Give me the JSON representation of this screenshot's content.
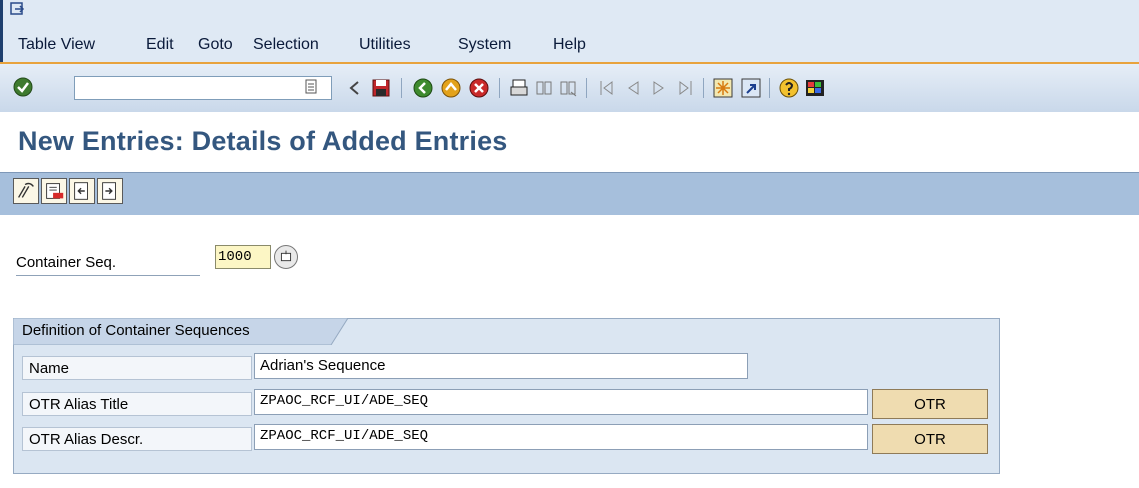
{
  "menu": {
    "items": [
      "Table View",
      "Edit",
      "Goto",
      "Selection",
      "Utilities",
      "System",
      "Help"
    ]
  },
  "toolbar": {
    "command_value": "",
    "icons": [
      "enter-icon",
      "history-dropdown-icon",
      "back-arrow-icon",
      "save-icon",
      "back-icon",
      "exit-icon",
      "cancel-icon",
      "print-icon",
      "find-icon",
      "find-next-icon",
      "first-page-icon",
      "previous-page-icon",
      "next-page-icon",
      "last-page-icon",
      "create-session-icon",
      "shortcut-icon",
      "help-icon",
      "customize-layout-icon"
    ]
  },
  "page": {
    "title": "New Entries: Details of Added Entries"
  },
  "app_toolbar": {
    "icons": [
      "change-display-icon",
      "delete-icon",
      "previous-entry-icon",
      "next-entry-icon"
    ]
  },
  "form": {
    "container_seq_label": "Container Seq.",
    "container_seq_value": "1000",
    "group_title": "Definition of Container Sequences",
    "name_label": "Name",
    "name_value": "Adrian's Sequence",
    "otr_title_label": "OTR Alias Title",
    "otr_title_value": "ZPAOC_RCF_UI/ADE_SEQ",
    "otr_descr_label": "OTR Alias Descr.",
    "otr_descr_value": "ZPAOC_RCF_UI/ADE_SEQ",
    "otr_button_label": "OTR"
  },
  "colors": {
    "title": "#34577f",
    "menubar": "#dfe9f4",
    "toolbar_accent": "#e8a33d",
    "group_bg": "#dbe6f2",
    "otr_button": "#efdcb0",
    "required_field": "#fcf6c5"
  }
}
